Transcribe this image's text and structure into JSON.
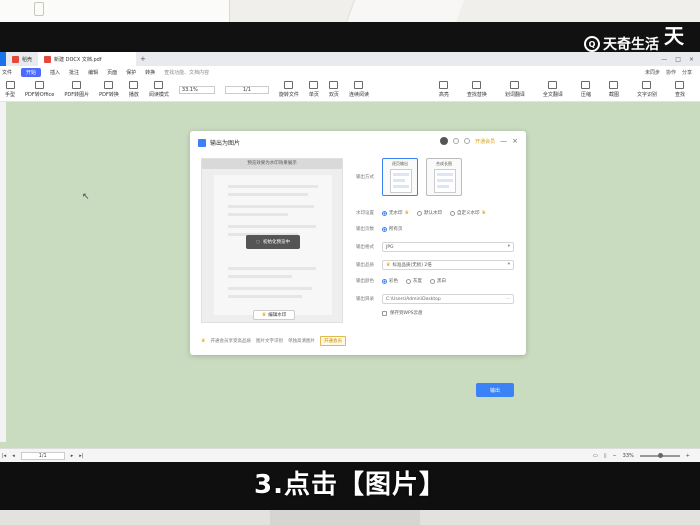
{
  "watermark": {
    "brand": "天奇生活",
    "logo_glyph": "Q",
    "corner_text": "天奇"
  },
  "browser": {
    "tabs": [
      {
        "label": "稻壳",
        "color": "#e5483a"
      },
      {
        "label": "新建 DOCX 文档.pdf",
        "color": "#e5483a"
      }
    ],
    "plus": "+",
    "window_controls": [
      "—",
      "□",
      "×"
    ]
  },
  "menu": {
    "file": "文件",
    "items": [
      "开始",
      "插入",
      "批注",
      "编辑",
      "页面",
      "保护",
      "转换"
    ],
    "search": "查找功能、文档内容",
    "right": [
      "未同步",
      "协作",
      "分享"
    ]
  },
  "toolbar": {
    "tools": [
      "手型",
      "PDF转Office",
      "PDF转图片",
      "PDF转换",
      "播放",
      "阅读模式"
    ],
    "zoom": "33.1%",
    "page": "1/1",
    "tools2": [
      "旋转文件",
      "单页",
      "双页",
      "连续阅读"
    ],
    "right_tools": [
      "高亮",
      "查找替换",
      "划词翻译",
      "全文翻译",
      "压缩",
      "截图",
      "文字识别",
      "查找"
    ]
  },
  "dialog": {
    "title": "输出为图片",
    "upgrade": "开通会员",
    "controls": {
      "minimize": "—",
      "close": "×"
    },
    "preview_header": "预览效果为水印效果展示",
    "loading": "初始化预览中",
    "edit_button": "编辑水印",
    "fields": {
      "mode_label": "输出方式",
      "modes": [
        "逐页输出",
        "合成长图"
      ],
      "watermark_label": "水印设置",
      "watermark_options": [
        "无水印",
        "默认水印",
        "自定义水印"
      ],
      "pages_label": "输出页数",
      "pages_options": [
        "所有页"
      ],
      "format_label": "输出格式",
      "format_value": "JPG",
      "quality_label": "输出品质",
      "quality_value": "标准品质(无损) 2倍",
      "color_label": "输出颜色",
      "color_options": [
        "彩色",
        "灰度",
        "黑白"
      ],
      "dir_label": "输出目录",
      "dir_value": "C:\\Users\\Admin\\Desktop",
      "dir_more": "...",
      "save_option": "保存到WPS云盘"
    },
    "footer": {
      "note": "开通会员享受高品质",
      "links": [
        "图片文字识别",
        "单独高清图片"
      ],
      "member_button": "开通会员"
    },
    "export_button": "输出"
  },
  "statusbar": {
    "page": "1/1",
    "zoom": "33%"
  },
  "caption": "3.点击【图片】",
  "colors": {
    "accent": "#3b82f6",
    "screen_bg": "#c9dcc0",
    "crown": "#e6a01a"
  }
}
